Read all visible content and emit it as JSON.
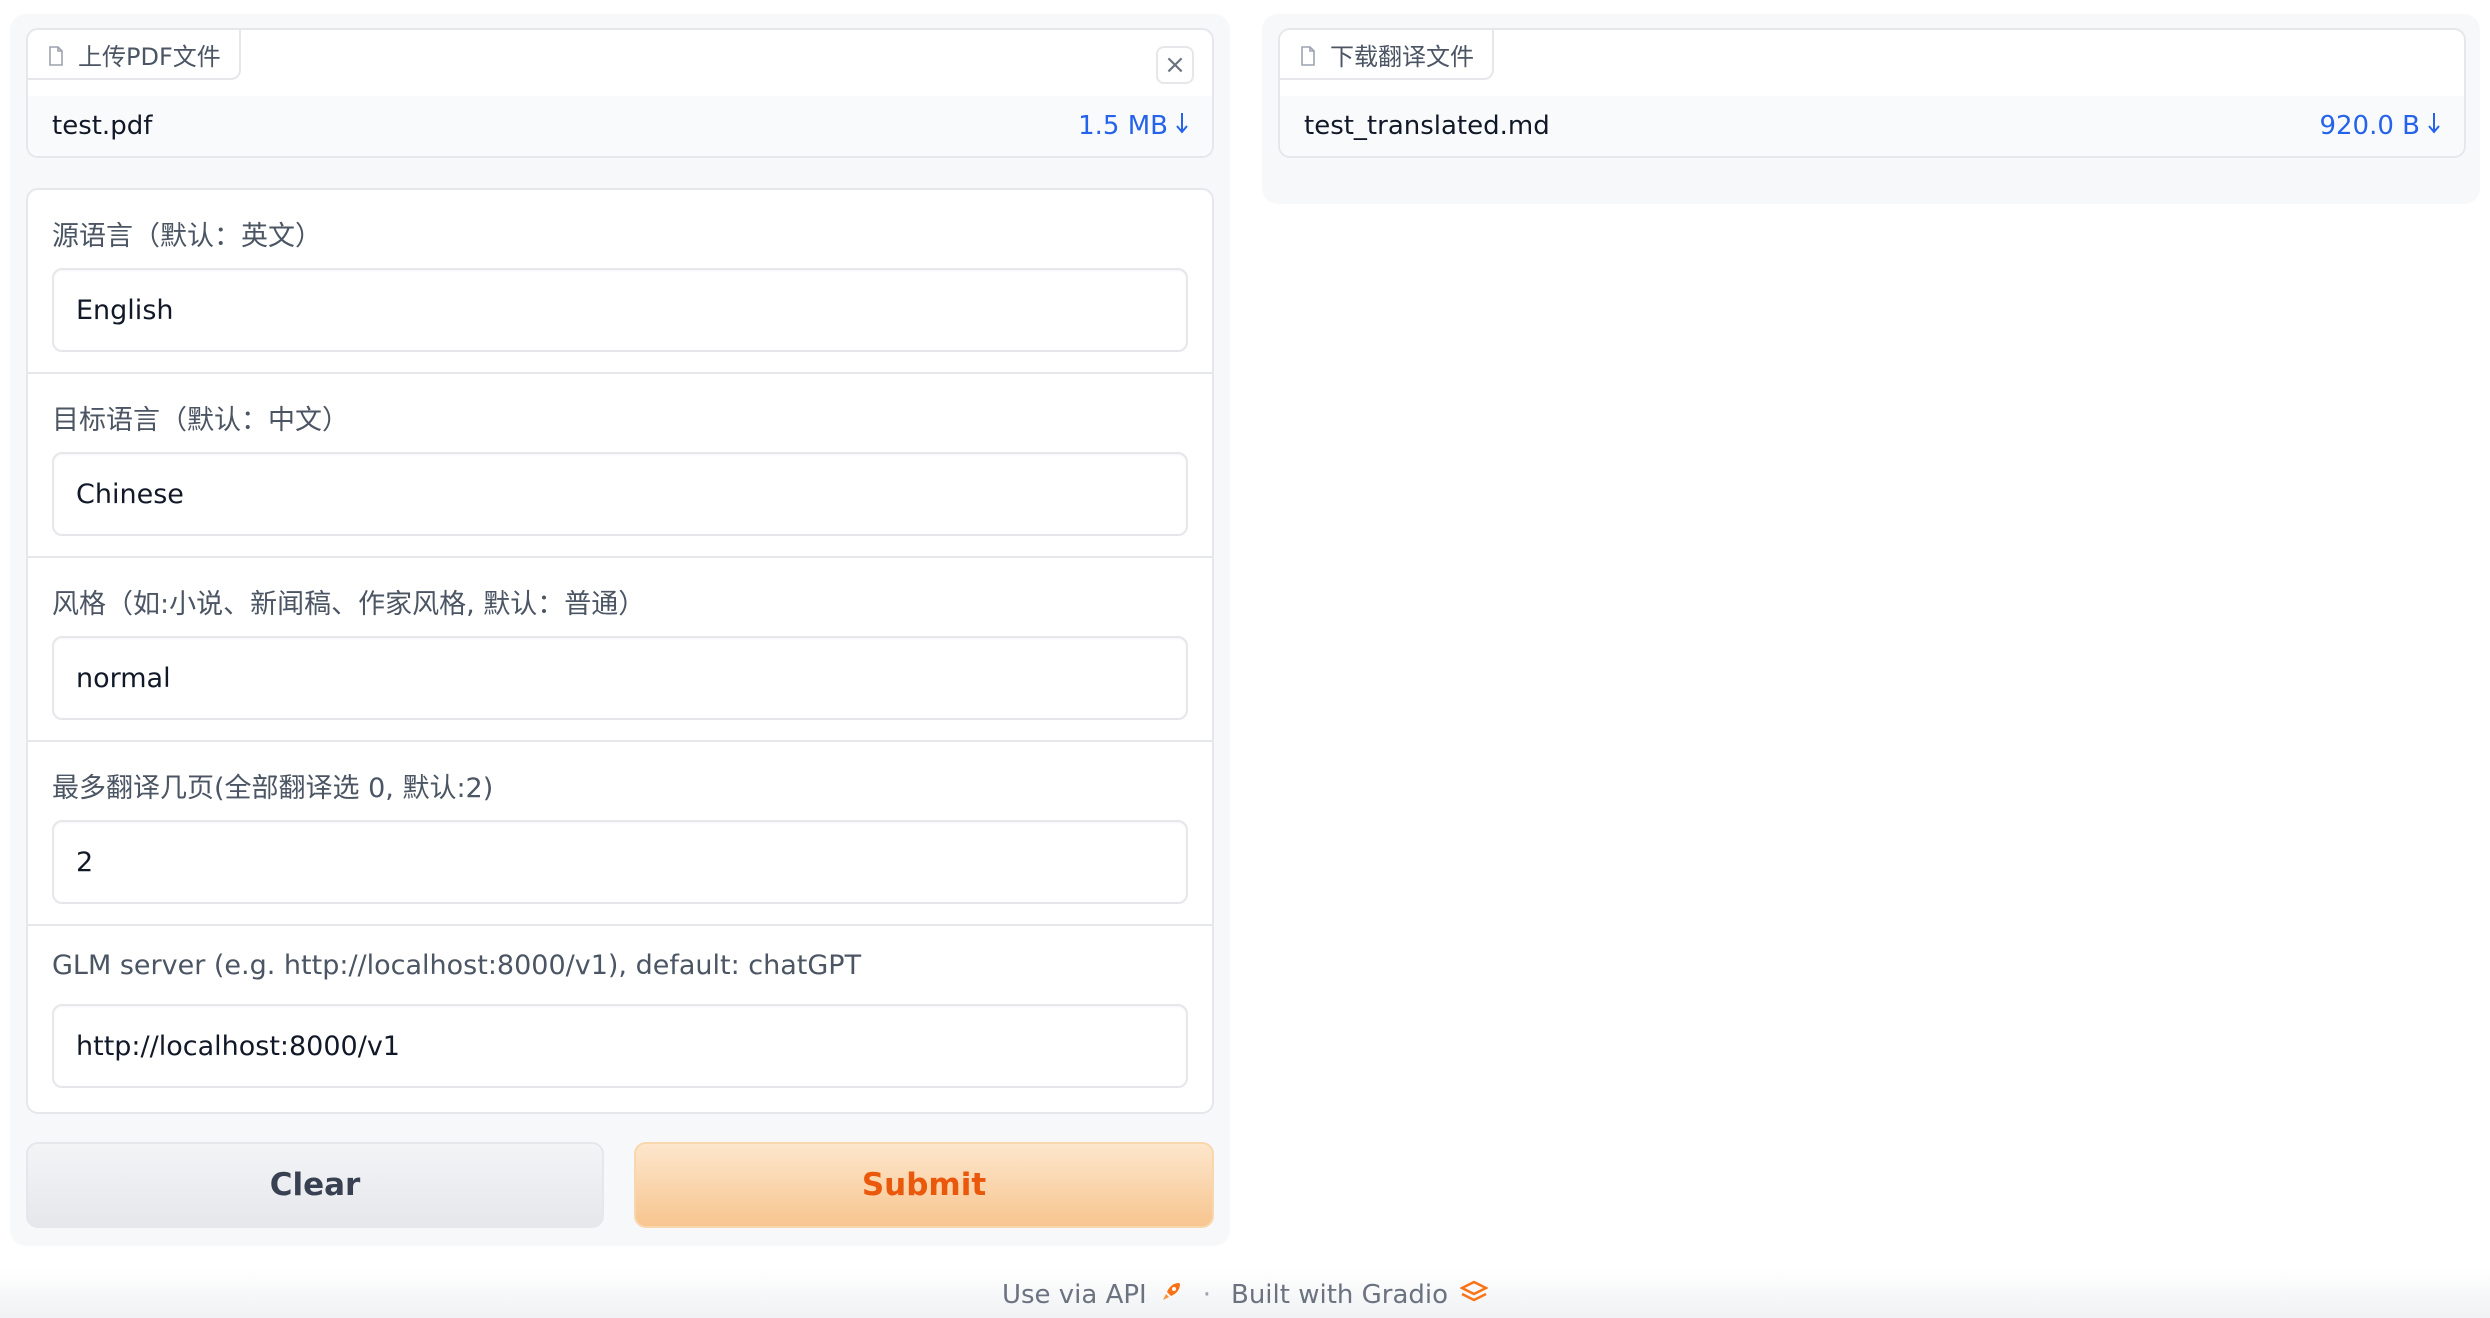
{
  "upload": {
    "tab_label": "上传PDF文件",
    "file_name": "test.pdf",
    "file_size": "1.5 MB",
    "close_glyph": "×"
  },
  "download": {
    "tab_label": "下载翻译文件",
    "file_name": "test_translated.md",
    "file_size": "920.0 B"
  },
  "fields": {
    "source": {
      "label": "源语言（默认：英文）",
      "value": "English"
    },
    "target": {
      "label": "目标语言（默认：中文）",
      "value": "Chinese"
    },
    "style": {
      "label": "风格（如:小说、新闻稿、作家风格, 默认：普通）",
      "value": "normal"
    },
    "pages": {
      "label": "最多翻译几页(全部翻译选 0, 默认:2)",
      "value": "2"
    },
    "server": {
      "label": "GLM server (e.g. http://localhost:8000/v1), default: chatGPT",
      "value": "http://localhost:8000/v1"
    }
  },
  "buttons": {
    "clear": "Clear",
    "submit": "Submit"
  },
  "footer": {
    "api_link": "Use via API",
    "separator": "·",
    "built_with": "Built with Gradio"
  },
  "colors": {
    "accent": "#ea580c",
    "link": "#2563eb",
    "border": "#e5e7eb"
  }
}
